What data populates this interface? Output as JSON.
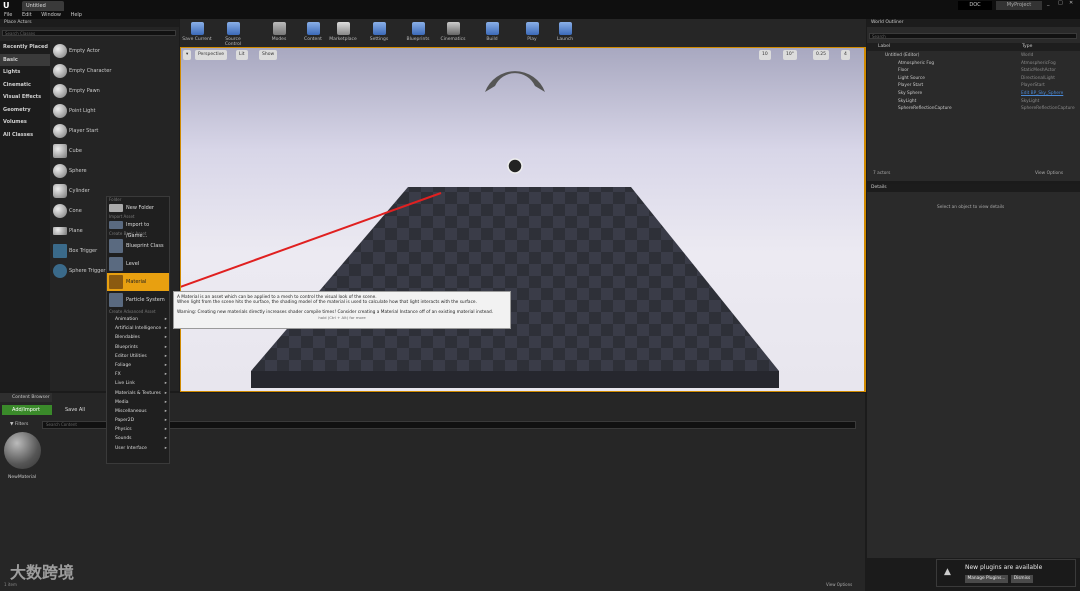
{
  "app": {
    "tab_title": "Untitled",
    "project": "MyProject",
    "source_btn": "DOC"
  },
  "menu": [
    "File",
    "Edit",
    "Window",
    "Help"
  ],
  "toolbar": [
    {
      "label": "Save Current"
    },
    {
      "label": "Source Control"
    },
    {
      "label": "Modes"
    },
    {
      "label": "Content"
    },
    {
      "label": "Marketplace"
    },
    {
      "label": "Settings"
    },
    {
      "label": "Blueprints"
    },
    {
      "label": "Cinematics"
    },
    {
      "label": "Build"
    },
    {
      "label": "Play"
    },
    {
      "label": "Launch"
    }
  ],
  "place_actors": {
    "title": "Place Actors",
    "search_placeholder": "Search Classes",
    "categories": [
      "Recently Placed",
      "Basic",
      "Lights",
      "Cinematic",
      "Visual Effects",
      "Geometry",
      "Volumes",
      "All Classes"
    ],
    "items": [
      "Empty Actor",
      "Empty Character",
      "Empty Pawn",
      "Point Light",
      "Player Start",
      "Cube",
      "Sphere",
      "Cylinder",
      "Cone",
      "Plane",
      "Box Trigger",
      "Sphere Trigger"
    ]
  },
  "context_menu": {
    "sec_folder": "Folder",
    "new_folder": "New Folder",
    "sec_import": "Import Asset",
    "import_to": "Import to /Game...",
    "sec_basic": "Create Basic Asset",
    "basic": [
      "Blueprint Class",
      "Level",
      "Material",
      "Particle System"
    ],
    "sec_advanced": "Create Advanced Asset",
    "advanced": [
      "Animation",
      "Artificial Intelligence",
      "Blendables",
      "Blueprints",
      "Editor Utilities",
      "Foliage",
      "FX",
      "Live Link",
      "Materials & Textures",
      "Media",
      "Miscellaneous",
      "Paper2D",
      "Physics",
      "Sounds",
      "User Interface"
    ]
  },
  "tooltip": {
    "line1": "A Material is an asset which can be applied to a mesh to control the visual look of the scene.",
    "line2": "When light from the scene hits the surface, the shading model of the material is used to calculate how that light interacts with the surface.",
    "line3": "Warning: Creating new materials directly increases shader compile times!  Consider creating a Material Instance off of an existing material instead.",
    "hint": "hold (Ctrl + Alt) for more"
  },
  "viewport": {
    "perspective": "Perspective",
    "lit": "Lit",
    "show": "Show",
    "grid": "10",
    "rot": "10°",
    "scale": "0.25",
    "cam": "4"
  },
  "content_browser": {
    "tab": "Content Browser",
    "add_import": "Add/Import",
    "save_all": "Save All",
    "filters": "Filters",
    "search_placeholder": "Search Content",
    "asset": "NewMaterial",
    "count": "1 item",
    "view_options": "View Options"
  },
  "world_outliner": {
    "tab": "World Outliner",
    "search_placeholder": "Search",
    "col_label": "Label",
    "col_type": "Type",
    "rows": [
      {
        "label": "Untitled (Editor)",
        "type": "World"
      },
      {
        "label": "Atmospheric Fog",
        "type": "AtmosphericFog"
      },
      {
        "label": "Floor",
        "type": "StaticMeshActor"
      },
      {
        "label": "Light Source",
        "type": "DirectionalLight"
      },
      {
        "label": "Player Start",
        "type": "PlayerStart"
      },
      {
        "label": "Sky Sphere",
        "type": "Edit BP_Sky_Sphere"
      },
      {
        "label": "SkyLight",
        "type": "SkyLight"
      },
      {
        "label": "SphereReflectionCapture",
        "type": "SphereReflectionCapture"
      }
    ],
    "count": "7 actors",
    "view_options": "View Options"
  },
  "details": {
    "tab": "Details",
    "empty": "Select an object to view details"
  },
  "notification": {
    "text": "New plugins are available",
    "manage": "Manage Plugins...",
    "dismiss": "Dismiss"
  },
  "watermark": "大数跨境"
}
